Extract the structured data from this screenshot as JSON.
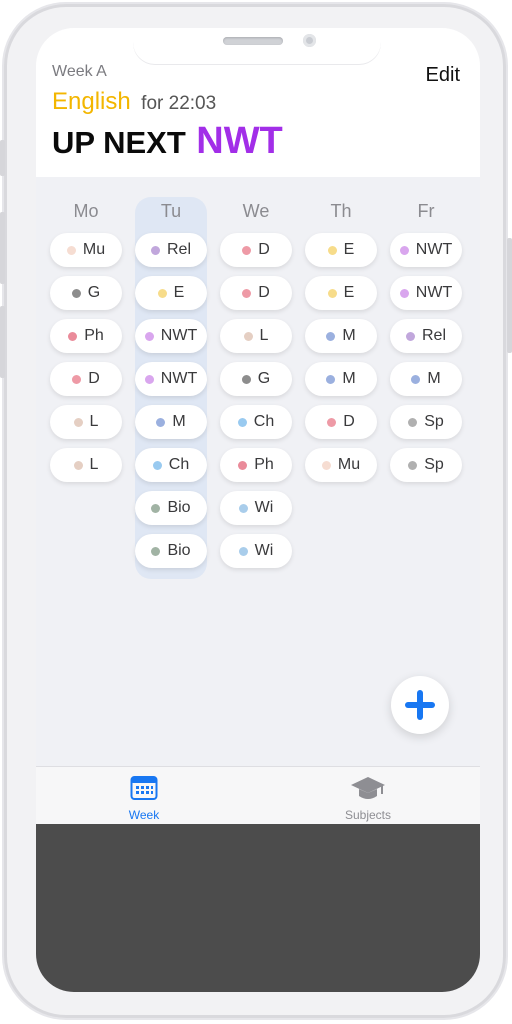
{
  "header": {
    "week_label": "Week A",
    "edit_label": "Edit",
    "current_subject": "English",
    "current_time": "for 22:03",
    "up_next_label": "UP NEXT",
    "up_next_subject": "NWT"
  },
  "colors": {
    "current_subject": "#f3b600",
    "up_next_subject": "#a22ee8",
    "highlight_column": "#dfe7f4",
    "accent_blue": "#1877f2"
  },
  "timetable": {
    "days": [
      {
        "label": "Mo",
        "highlighted": false,
        "lessons": [
          {
            "label": "Mu",
            "color": "#f6ddd2"
          },
          {
            "label": "G",
            "color": "#8d8d8d"
          },
          {
            "label": "Ph",
            "color": "#ea8b9a"
          },
          {
            "label": "D",
            "color": "#ee9aa6"
          },
          {
            "label": "L",
            "color": "#e5cfc3"
          },
          {
            "label": "L",
            "color": "#e5cfc3"
          }
        ]
      },
      {
        "label": "Tu",
        "highlighted": true,
        "lessons": [
          {
            "label": "Rel",
            "color": "#c1a7dc"
          },
          {
            "label": "E",
            "color": "#f7dc8a"
          },
          {
            "label": "NWT",
            "color": "#d9a6ee"
          },
          {
            "label": "NWT",
            "color": "#d9a6ee"
          },
          {
            "label": "M",
            "color": "#9bb0df"
          },
          {
            "label": "Ch",
            "color": "#99caf0"
          },
          {
            "label": "Bio",
            "color": "#a1b3a4"
          },
          {
            "label": "Bio",
            "color": "#a1b3a4"
          }
        ]
      },
      {
        "label": "We",
        "highlighted": false,
        "lessons": [
          {
            "label": "D",
            "color": "#ee9aa6"
          },
          {
            "label": "D",
            "color": "#ee9aa6"
          },
          {
            "label": "L",
            "color": "#e5cfc3"
          },
          {
            "label": "G",
            "color": "#8d8d8d"
          },
          {
            "label": "Ch",
            "color": "#99caf0"
          },
          {
            "label": "Ph",
            "color": "#ea8b9a"
          },
          {
            "label": "Wi",
            "color": "#a9cdeb"
          },
          {
            "label": "Wi",
            "color": "#a9cdeb"
          }
        ]
      },
      {
        "label": "Th",
        "highlighted": false,
        "lessons": [
          {
            "label": "E",
            "color": "#f7dc8a"
          },
          {
            "label": "E",
            "color": "#f7dc8a"
          },
          {
            "label": "M",
            "color": "#9bb0df"
          },
          {
            "label": "M",
            "color": "#9bb0df"
          },
          {
            "label": "D",
            "color": "#ee9aa6"
          },
          {
            "label": "Mu",
            "color": "#f6ddd2"
          }
        ]
      },
      {
        "label": "Fr",
        "highlighted": false,
        "lessons": [
          {
            "label": "NWT",
            "color": "#d9a6ee"
          },
          {
            "label": "NWT",
            "color": "#d9a6ee"
          },
          {
            "label": "Rel",
            "color": "#c1a7dc"
          },
          {
            "label": "M",
            "color": "#9bb0df"
          },
          {
            "label": "Sp",
            "color": "#b0b0b0"
          },
          {
            "label": "Sp",
            "color": "#b0b0b0"
          }
        ]
      }
    ]
  },
  "fab": {
    "icon": "plus-icon"
  },
  "tabbar": {
    "tabs": [
      {
        "label": "Week",
        "icon": "calendar-icon",
        "active": true
      },
      {
        "label": "Subjects",
        "icon": "graduation-cap-icon",
        "active": false
      }
    ]
  }
}
